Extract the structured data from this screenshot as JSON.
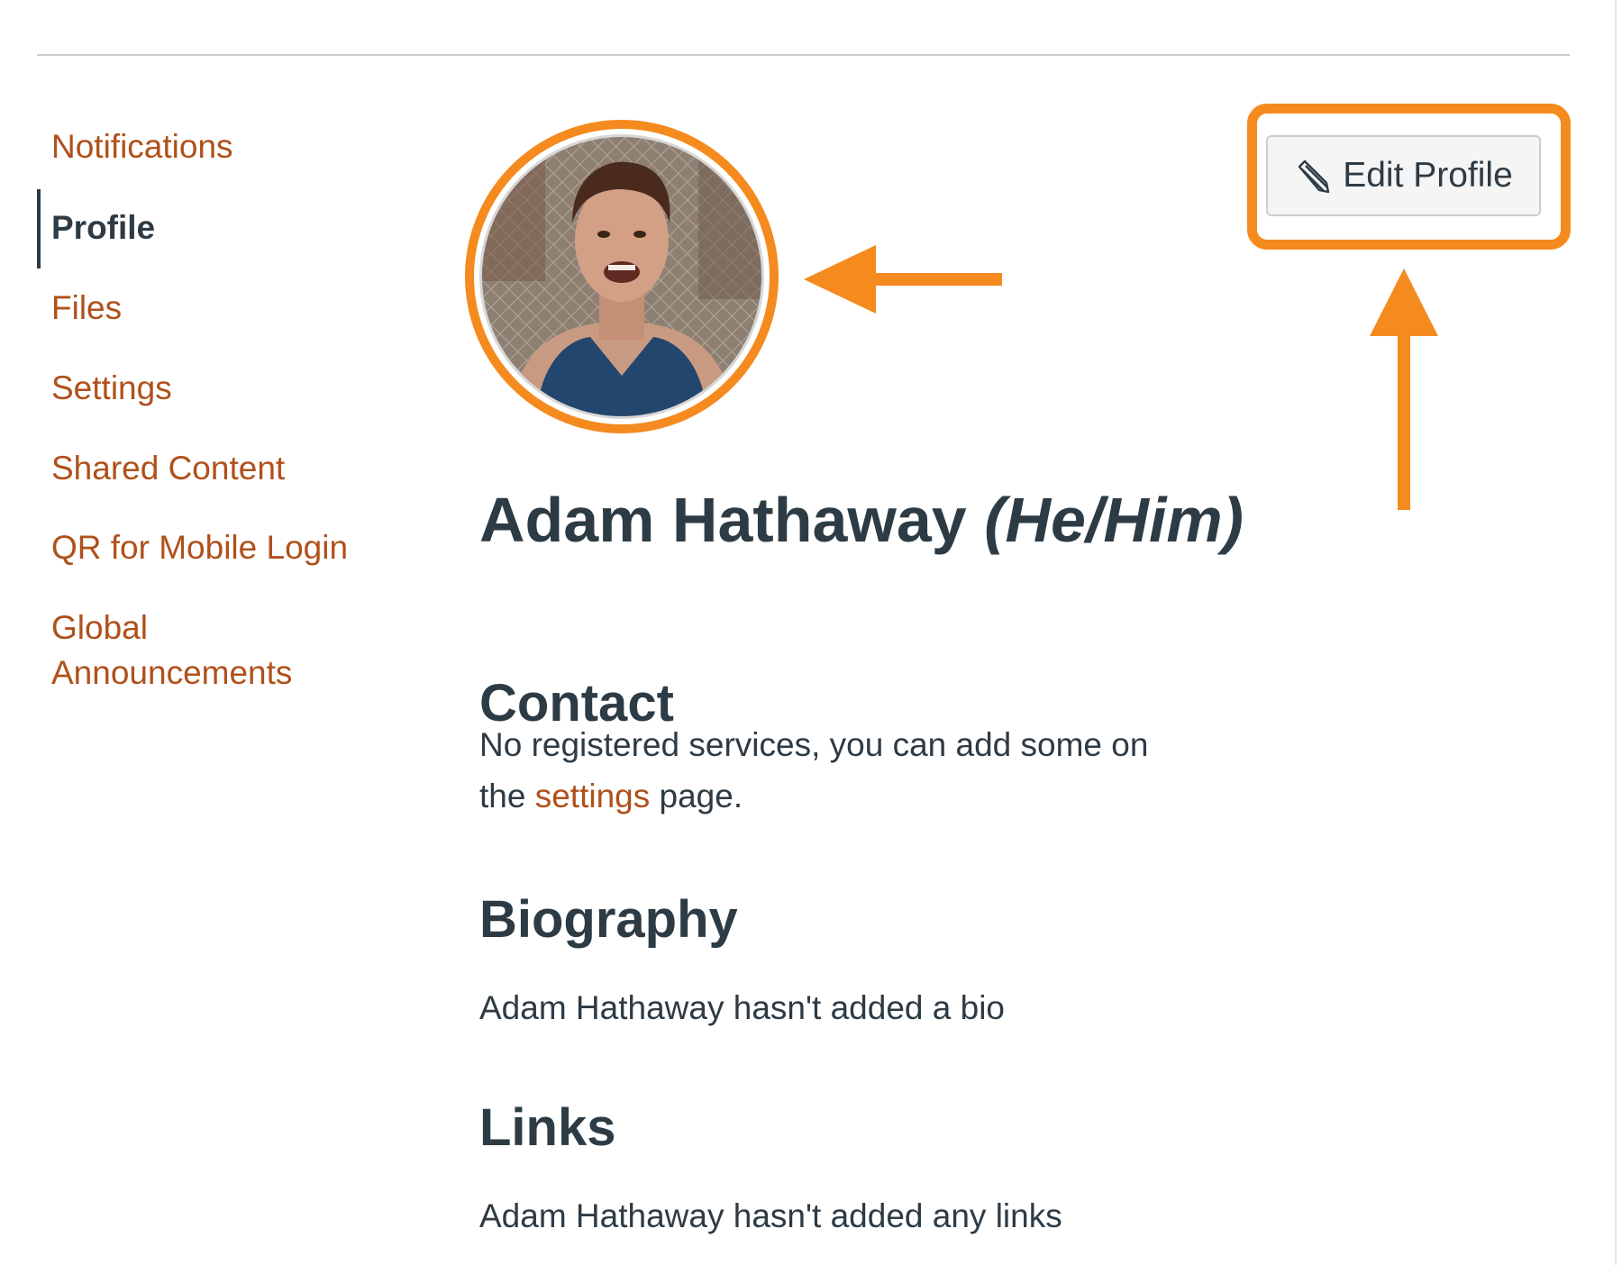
{
  "sidebar": {
    "items": [
      {
        "label": "Notifications",
        "active": false
      },
      {
        "label": "Profile",
        "active": true
      },
      {
        "label": "Files",
        "active": false
      },
      {
        "label": "Settings",
        "active": false
      },
      {
        "label": "Shared Content",
        "active": false
      },
      {
        "label": "QR for Mobile Login",
        "active": false
      },
      {
        "label": "Global Announcements",
        "active": false
      }
    ]
  },
  "profile": {
    "name": "Adam Hathaway",
    "pronouns": "(He/Him)",
    "edit_button_label": "Edit Profile"
  },
  "contact": {
    "heading": "Contact",
    "text_before": "No registered services, you can add some on the ",
    "link_text": "settings",
    "text_after": " page."
  },
  "biography": {
    "heading": "Biography",
    "text": "Adam Hathaway hasn't added a bio"
  },
  "links": {
    "heading": "Links",
    "text": "Adam Hathaway hasn't added any links"
  },
  "icons": {
    "edit": "pencil-icon"
  },
  "colors": {
    "link": "#b0501a",
    "text": "#2d3b45",
    "highlight": "#f58a1f",
    "button_bg": "#f5f5f5",
    "rule": "#c7cdd1"
  }
}
